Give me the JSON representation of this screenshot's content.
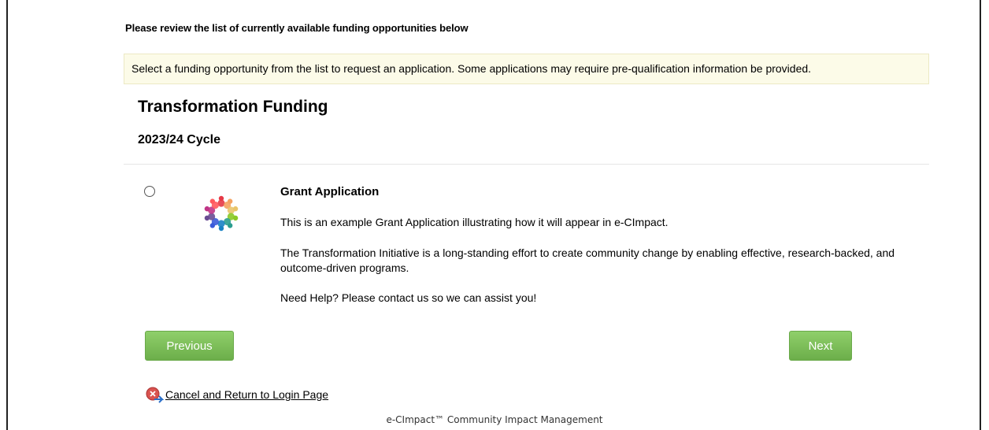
{
  "intro": {
    "heading": "Please review the list of currently available funding opportunities below",
    "banner": "Select a funding opportunity from the list to request an application. Some applications may require pre-qualification information be provided."
  },
  "program": {
    "title": "Transformation Funding",
    "cycle": "2023/24 Cycle"
  },
  "opportunity": {
    "title": "Grant Application",
    "description_1": "This is an example Grant Application illustrating how it will appear in e-CImpact.",
    "description_2": "The Transformation Initiative is a long-standing effort to create community change by enabling effective, research-backed, and outcome-driven programs.",
    "description_3": "Need Help? Please contact us so we can assist you!",
    "logo_icon": "people-circle-logo-icon",
    "selected": false
  },
  "navigation": {
    "previous_label": "Previous",
    "next_label": "Next",
    "cancel_label": "Cancel and Return to Login Page",
    "cancel_icon": "cancel-return-icon"
  },
  "footer": {
    "text": "e-CImpact™ Community Impact Management"
  },
  "colors": {
    "button_green": "#7ebf5a",
    "banner_bg": "#fcfbe8"
  }
}
